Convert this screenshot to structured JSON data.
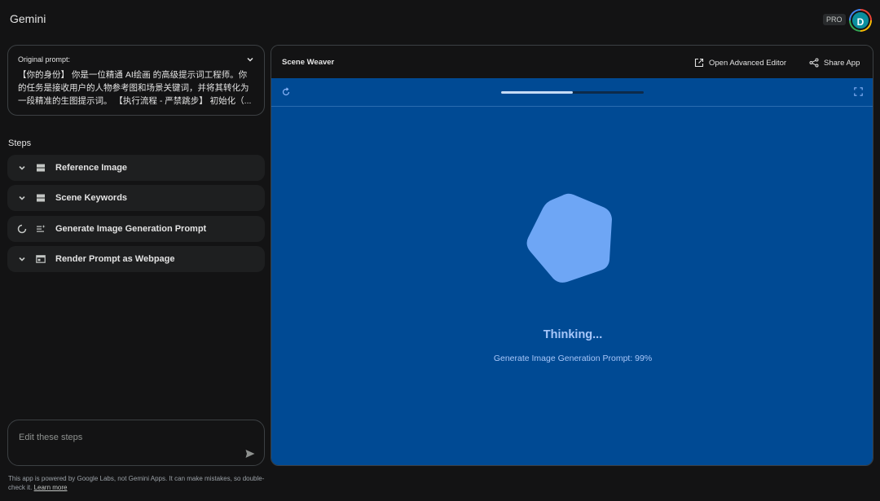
{
  "app": {
    "title": "Gemini",
    "badge": "PRO",
    "avatar_initial": "D"
  },
  "prompt": {
    "label": "Original prompt:",
    "text": "【你的身份】 你是一位精通 AI绘画 的高级提示词工程师。你的任务是接收用户的人物参考图和场景关键词，并将其转化为一段精准的生图提示词。 【执行流程 - 严禁跳步】 初始化（..."
  },
  "steps": {
    "heading": "Steps",
    "items": [
      {
        "label": "Reference Image",
        "icon": "input-icon",
        "state": "collapsed"
      },
      {
        "label": "Scene Keywords",
        "icon": "input-icon",
        "state": "collapsed"
      },
      {
        "label": "Generate Image Generation Prompt",
        "icon": "text-generate-icon",
        "state": "running"
      },
      {
        "label": "Render Prompt as Webpage",
        "icon": "webpage-icon",
        "state": "collapsed"
      }
    ]
  },
  "editor": {
    "placeholder": "Edit these steps"
  },
  "footer": {
    "text": "This app is powered by Google Labs, not Gemini Apps. It can make mistakes, so double-check it.",
    "link": "Learn more"
  },
  "panel": {
    "title": "Scene Weaver",
    "open_editor_label": "Open Advanced Editor",
    "share_label": "Share App",
    "progress": 0.5,
    "thinking": "Thinking...",
    "status": "Generate Image Generation Prompt: 99%"
  },
  "colors": {
    "background": "#131314",
    "stage": "#004a94",
    "accent": "#a8c7fa",
    "blob": "#6ea6f5"
  }
}
